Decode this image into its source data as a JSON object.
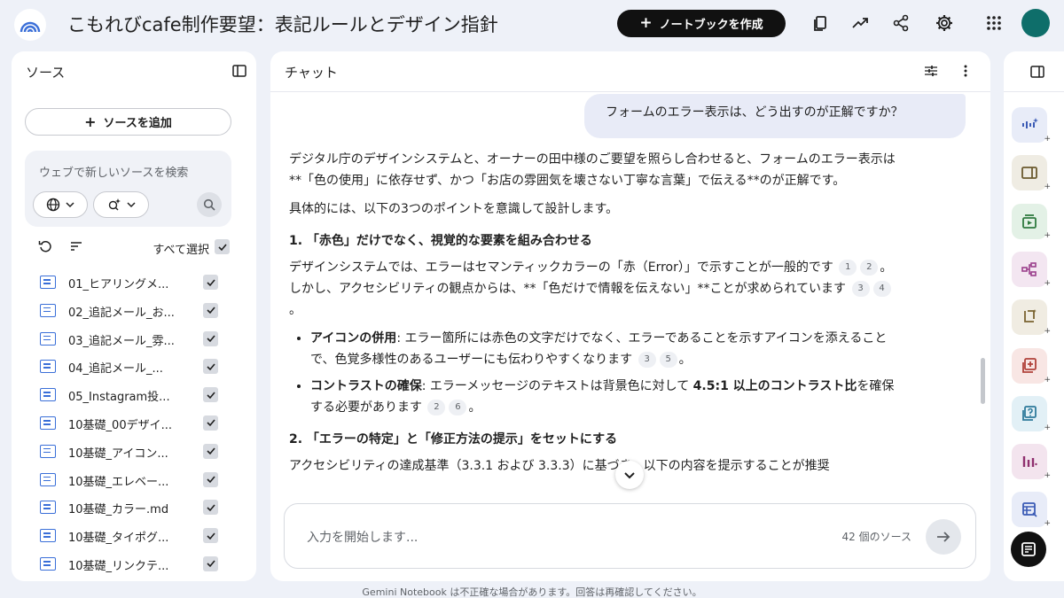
{
  "app": {
    "title": "こもれびcafe制作要望：表記ルールとデザイン指針",
    "create_button": "ノートブックを作成",
    "accent": "#111111",
    "avatar_color": "#0e6e6a"
  },
  "sources": {
    "header": "ソース",
    "add_button": "ソースを追加",
    "search_placeholder": "ウェブで新しいソースを検索",
    "select_all": "すべて選択",
    "items": [
      {
        "label": "01_ヒアリングメ..."
      },
      {
        "label": "02_追記メール_お..."
      },
      {
        "label": "03_追記メール_雰..."
      },
      {
        "label": "04_追記メール_..."
      },
      {
        "label": "05_Instagram投..."
      },
      {
        "label": "10基礎_00デザイ..."
      },
      {
        "label": "10基礎_アイコン..."
      },
      {
        "label": "10基礎_エレベー..."
      },
      {
        "label": "10基礎_カラー.md"
      },
      {
        "label": "10基礎_タイポグ..."
      },
      {
        "label": "10基礎_リンクテ..."
      }
    ]
  },
  "chat": {
    "header": "チャット",
    "user_message": "フォームのエラー表示は、どう出すのが正解ですか？",
    "answer": {
      "p1": "デジタル庁のデザインシステムと、オーナーの田中様のご要望を照らし合わせると、フォームのエラー表示は**「色の使用」に依存せず、かつ「お店の雰囲気を壊さない丁寧な言葉」で伝える**のが正解です。",
      "p2": "具体的には、以下の3つのポイントを意識して設計します。",
      "h1": "1. 「赤色」だけでなく、視覚的な要素を組み合わせる",
      "p3a": "デザインシステムでは、エラーはセマンティックカラーの「赤（Error）」で示すことが一般的です",
      "c1": "1",
      "c2": "2",
      "p3b": "。しかし、アクセシビリティの観点からは、**「色だけで情報を伝えない」**ことが求められています",
      "c3": "3",
      "c4": "4",
      "p3c": "。",
      "b1_strong": "アイコンの併用",
      "b1_text": ": エラー箇所には赤色の文字だけでなく、エラーであることを示すアイコンを添えることで、色覚多様性のあるユーザーにも伝わりやすくなります",
      "b1_c1": "3",
      "b1_c2": "5",
      "b1_end": "。",
      "b2_strong": "コントラストの確保",
      "b2_text1": ": エラーメッセージのテキストは背景色に対して ",
      "b2_strong2": "4.5:1 以上のコントラスト比",
      "b2_text2": "を確保する必要があります",
      "b2_c1": "2",
      "b2_c2": "6",
      "b2_end": "。",
      "h2": "2. 「エラーの特定」と「修正方法の提示」をセットにする",
      "p4": "アクセシビリティの達成基準（3.3.1 および 3.3.3）に基づき、以下の内容を提示することが推奨"
    },
    "input_placeholder": "入力を開始します...",
    "source_count": "42 個のソース"
  },
  "footer": "Gemini Notebook は不正確な場合があります。回答は再確認してください。",
  "studio": {
    "tools": [
      {
        "icon": "audio-overview-icon",
        "bg": "#e8ecf8",
        "color": "#3b5bb5"
      },
      {
        "icon": "video-overview-icon",
        "bg": "#efece3",
        "color": "#6b5a2e"
      },
      {
        "icon": "slides-icon",
        "bg": "#e3f1e6",
        "color": "#2f7a3f"
      },
      {
        "icon": "mind-map-icon",
        "bg": "#f3e6f1",
        "color": "#9b3f8c"
      },
      {
        "icon": "report-icon",
        "bg": "#f0ece2",
        "color": "#7a6330"
      },
      {
        "icon": "flashcards-icon",
        "bg": "#f8e6e4",
        "color": "#b0413a"
      },
      {
        "icon": "quiz-icon",
        "bg": "#e2f0f6",
        "color": "#2e7a9b"
      },
      {
        "icon": "infographic-icon",
        "bg": "#f3e4ee",
        "color": "#8f2f6e"
      },
      {
        "icon": "data-table-icon",
        "bg": "#e8ecf8",
        "color": "#3b5bb5"
      }
    ]
  }
}
